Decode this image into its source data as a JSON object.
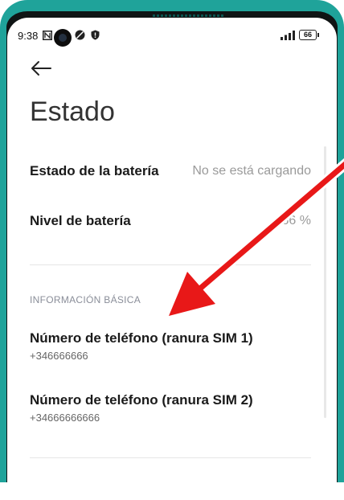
{
  "status_bar": {
    "time": "9:38",
    "battery": "66",
    "icons": [
      "nfc-icon",
      "camera-icon",
      "dark-mode-icon",
      "shield-icon",
      "signal-icon",
      "battery-icon"
    ]
  },
  "header": {
    "back_icon": "back-arrow-icon",
    "title": "Estado"
  },
  "battery_section": {
    "items": [
      {
        "label": "Estado de la batería",
        "value": "No se está cargando"
      },
      {
        "label": "Nivel de batería",
        "value": "66 %"
      }
    ]
  },
  "basic_info": {
    "header": "INFORMACIÓN BÁSICA",
    "items": [
      {
        "label": "Número de teléfono (ranura SIM 1)",
        "value": "+346666666"
      },
      {
        "label": "Número de teléfono (ranura SIM 2)",
        "value": "+34666666666"
      }
    ]
  },
  "annotation": {
    "arrow_color": "#e81818"
  },
  "colors": {
    "frame": "#1fa39a",
    "title": "#333333",
    "section_header": "#8a8e99"
  }
}
